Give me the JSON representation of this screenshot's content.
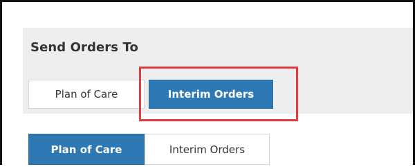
{
  "section": {
    "title": "Send Orders To"
  },
  "toggle_group_1": {
    "options": [
      {
        "label": "Plan of Care",
        "selected": false
      },
      {
        "label": "Interim Orders",
        "selected": true
      }
    ]
  },
  "toggle_group_2": {
    "options": [
      {
        "label": "Plan of Care",
        "selected": true
      },
      {
        "label": "Interim Orders",
        "selected": false
      }
    ]
  },
  "colors": {
    "selected_bg": "#2e78b4",
    "panel_bg": "#eeeeee",
    "highlight_border": "#e23b3b"
  }
}
